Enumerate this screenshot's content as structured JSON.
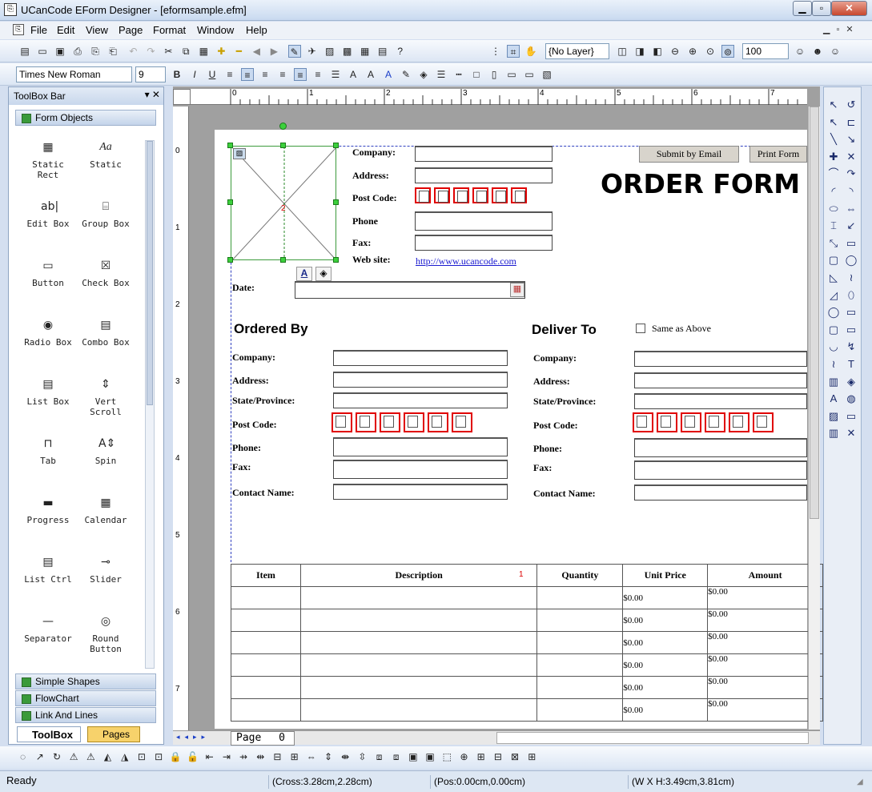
{
  "window": {
    "title": "UCanCode EForm Designer - [eformsample.efm]"
  },
  "menu": [
    "File",
    "Edit",
    "View",
    "Page",
    "Format",
    "Window",
    "Help"
  ],
  "toolbar": {
    "layer_select": "{No Layer}",
    "zoom": "100",
    "font": "Times New Roman",
    "font_size": "9"
  },
  "toolbox": {
    "title": "ToolBox Bar",
    "group_form_objects": "Form Objects",
    "tools": [
      [
        "Static",
        "Rect"
      ],
      [
        "Static"
      ],
      [
        "Edit Box"
      ],
      [
        "Group Box"
      ],
      [
        "Button"
      ],
      [
        "Check Box"
      ],
      [
        "Radio Box"
      ],
      [
        "Combo Box"
      ],
      [
        "List Box"
      ],
      [
        "Vert",
        "Scroll"
      ],
      [
        "Tab"
      ],
      [
        "Spin"
      ],
      [
        "Progress"
      ],
      [
        "Calendar"
      ],
      [
        "List Ctrl"
      ],
      [
        "Slider"
      ],
      [
        "Separator"
      ],
      [
        "Round",
        "Button"
      ]
    ],
    "group_simple_shapes": "Simple Shapes",
    "group_flowchart": "FlowChart",
    "group_link_lines": "Link And Lines",
    "tab_toolbox": "ToolBox",
    "tab_pages": "Pages"
  },
  "ruler": {
    "h": [
      "0",
      "1",
      "2",
      "3",
      "4",
      "5",
      "6",
      "7"
    ],
    "v": [
      "0",
      "1",
      "2",
      "3",
      "4",
      "5",
      "6",
      "7"
    ]
  },
  "form": {
    "title": "ORDER FORM",
    "submit": "Submit by Email",
    "print": "Print Form",
    "company": "Company:",
    "address": "Address:",
    "postcode": "Post Code:",
    "phone": "Phone",
    "fax": "Fax:",
    "website": "Web site:",
    "website_link": "http://www.ucancode.com",
    "date": "Date:",
    "ordered_by": "Ordered By",
    "deliver_to": "Deliver To",
    "same_as_above": "Same as Above",
    "left_labels": [
      "Company:",
      "Address:",
      "State/Province:",
      "Post Code:",
      "Phone:",
      "Fax:",
      "Contact Name:"
    ],
    "table_headers": [
      "Item",
      "Description",
      "Quantity",
      "Unit Price",
      "Amount"
    ],
    "price": "$0.00",
    "marker_1": "1",
    "marker_2": "2"
  },
  "page_tab": {
    "label": "Page",
    "num": "0"
  },
  "status": {
    "ready": "Ready",
    "cross": "(Cross:3.28cm,2.28cm)",
    "pos": "(Pos:0.00cm,0.00cm)",
    "size": "(W X H:3.49cm,3.81cm)"
  }
}
